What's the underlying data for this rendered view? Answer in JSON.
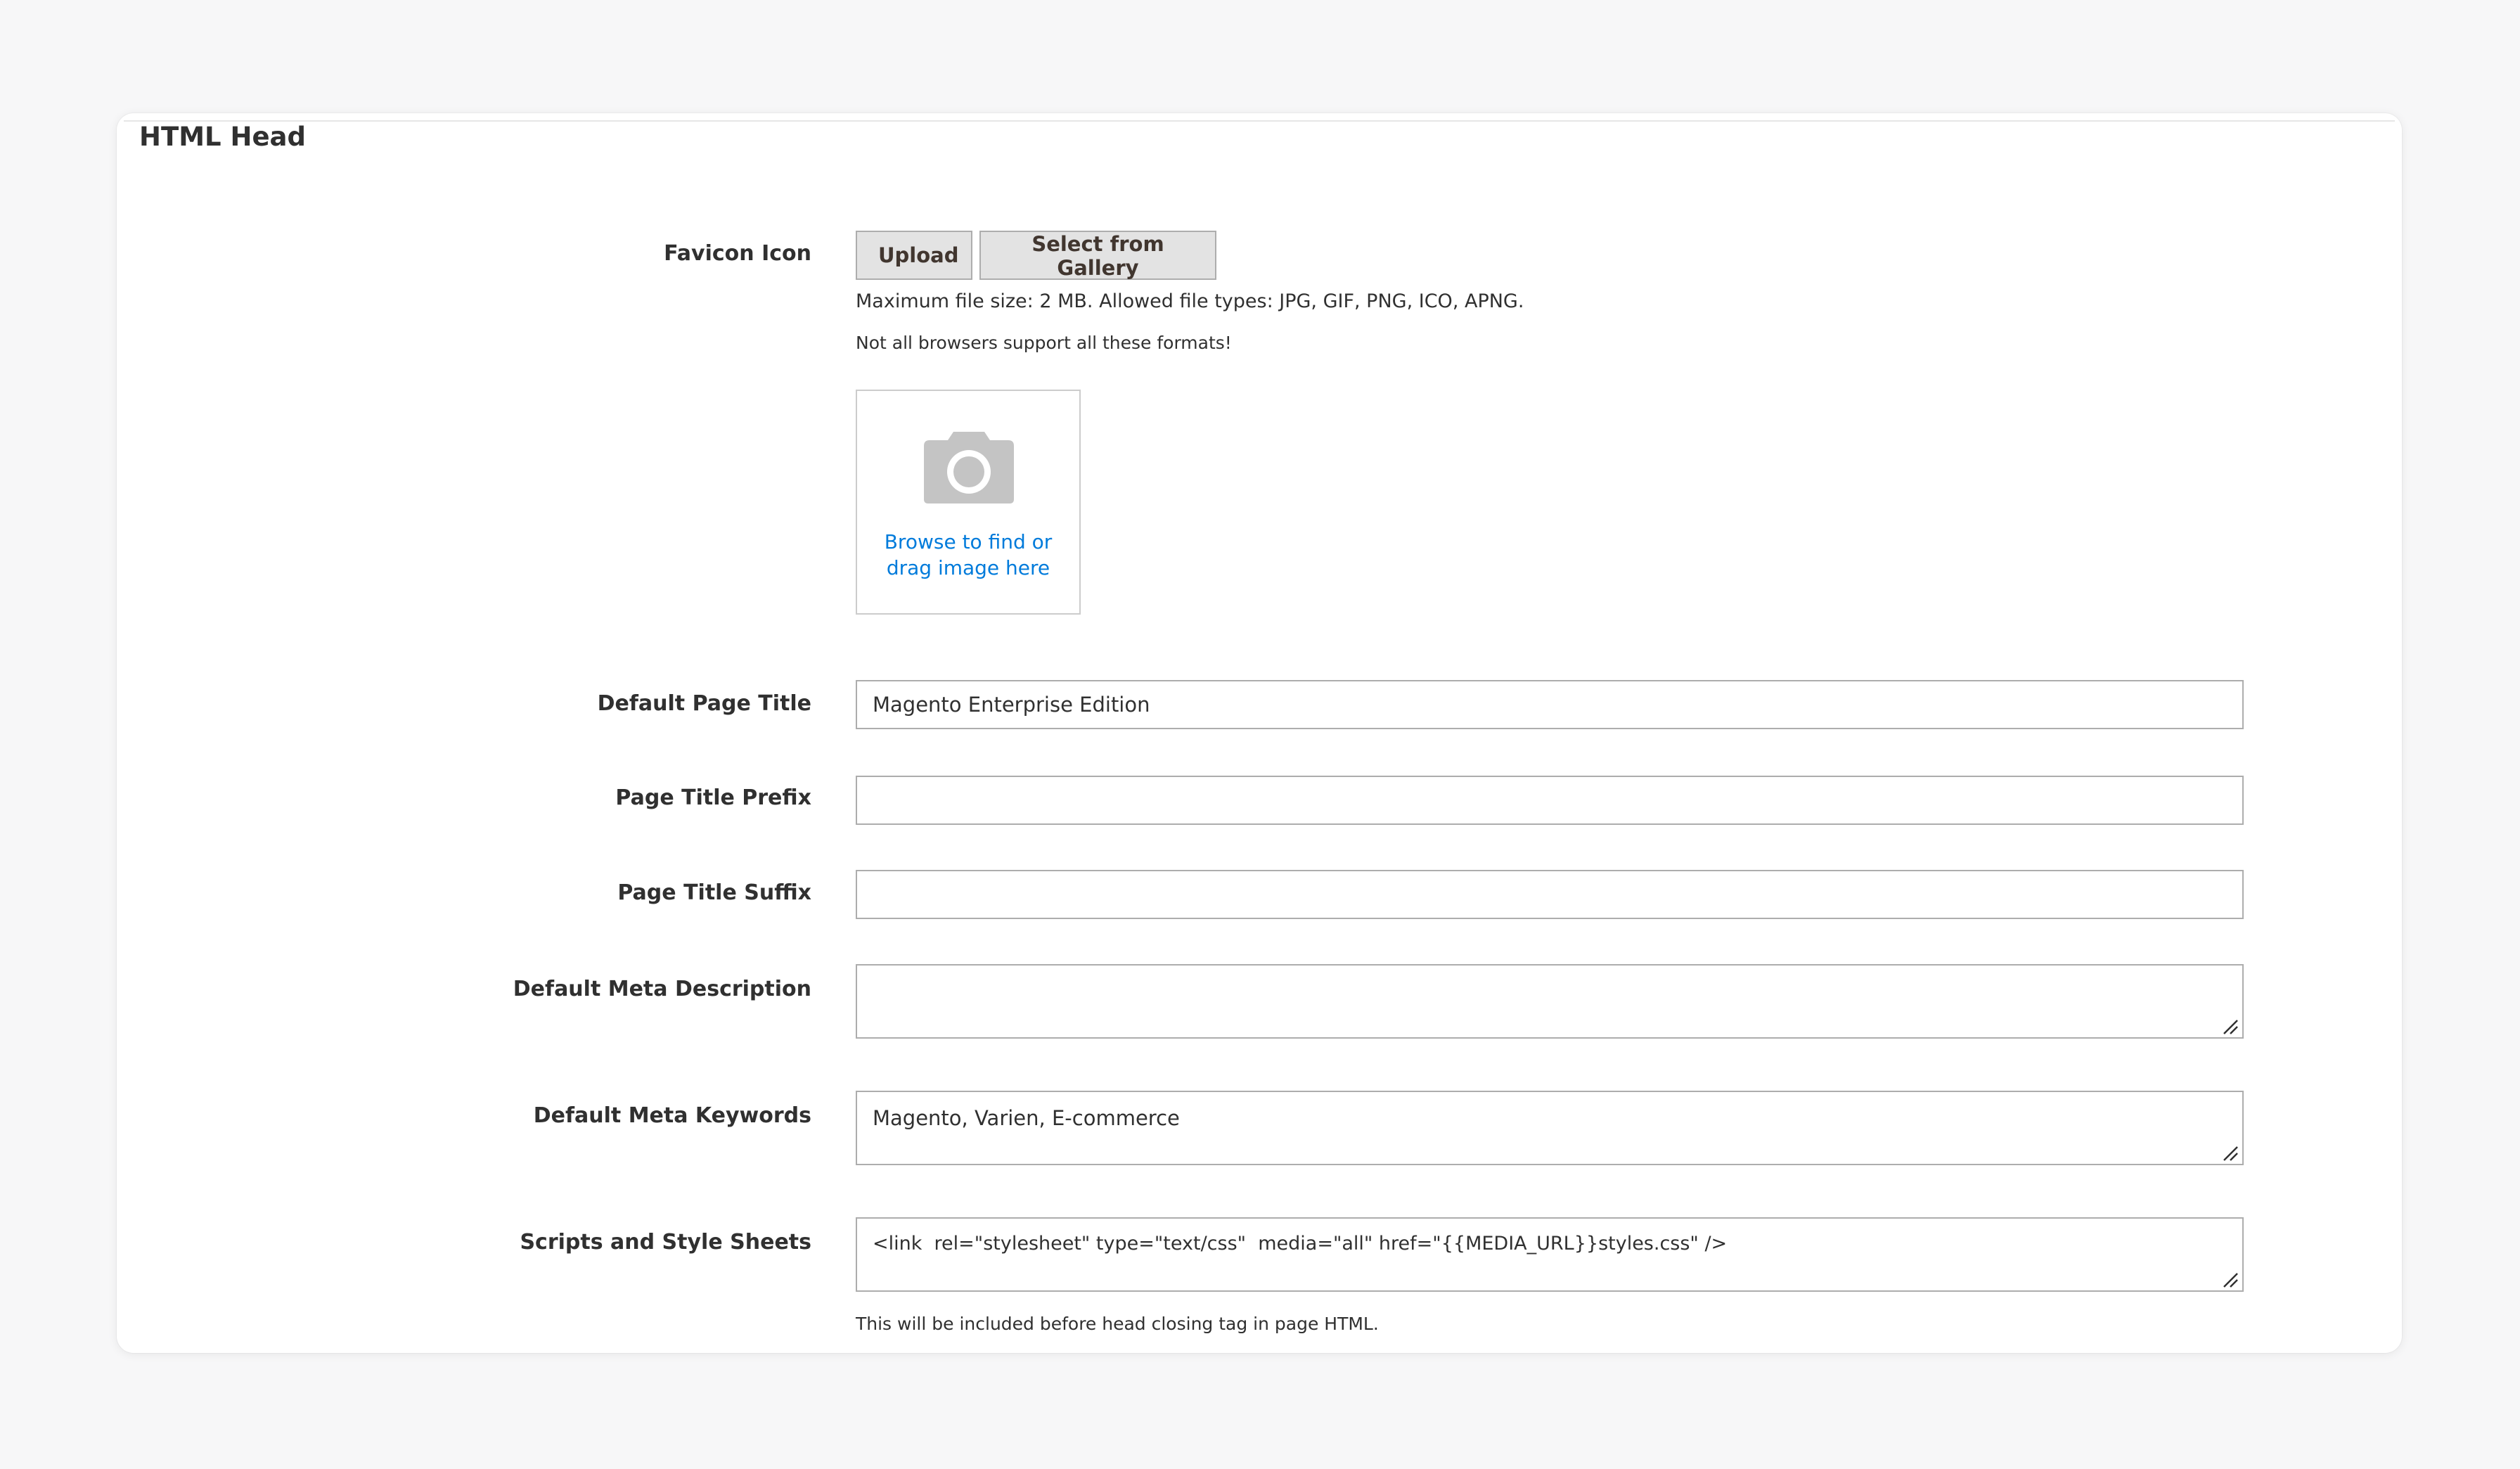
{
  "section": {
    "title": "HTML Head"
  },
  "favicon": {
    "label": "Favicon Icon",
    "upload_label": "Upload",
    "gallery_label": "Select from Gallery",
    "note_filesize": "Maximum file size: 2 MB. Allowed file types: JPG, GIF, PNG, ICO, APNG.",
    "note_browsers": "Not all browsers support all these formats!",
    "dropzone_line1": "Browse to find or",
    "dropzone_line2": "drag image here"
  },
  "fields": {
    "default_page_title": {
      "label": "Default Page Title",
      "value": "Magento Enterprise Edition"
    },
    "page_title_prefix": {
      "label": "Page Title Prefix",
      "value": ""
    },
    "page_title_suffix": {
      "label": "Page Title Suffix",
      "value": ""
    },
    "default_meta_description": {
      "label": "Default Meta Description",
      "value": ""
    },
    "default_meta_keywords": {
      "label": "Default Meta Keywords",
      "value": "Magento, Varien, E-commerce"
    },
    "scripts_and_style_sheets": {
      "label": "Scripts and Style Sheets",
      "value": "<link  rel=\"stylesheet\" type=\"text/css\"  media=\"all\" href=\"{{MEDIA_URL}}styles.css\" />",
      "note": "This will be included before head closing tag in page HTML."
    }
  },
  "colors": {
    "link": "#007bdb",
    "button_bg": "#e3e3e3",
    "input_border": "#adadad",
    "text": "#303030"
  },
  "icons": {
    "dropzone": "camera-icon",
    "textarea_resize": "resize-handle-icon"
  }
}
